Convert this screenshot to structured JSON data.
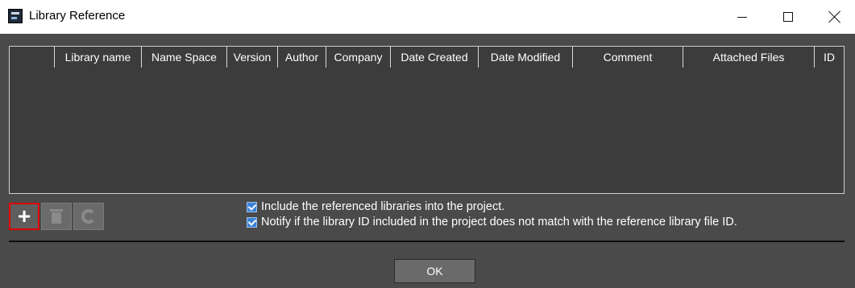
{
  "window": {
    "title": "Library Reference",
    "icon": "library-reference-app-icon",
    "controls": {
      "minimize": "minimize-icon",
      "maximize": "maximize-icon",
      "close": "close-icon"
    }
  },
  "grid": {
    "columns": [
      "",
      "Library name",
      "Name Space",
      "Version",
      "Author",
      "Company",
      "Date Created",
      "Date Modified",
      "Comment",
      "Attached Files",
      "ID"
    ],
    "rows": []
  },
  "toolbar": {
    "add_icon": "plus-icon",
    "delete_icon": "trash-icon",
    "refresh_icon": "refresh-icon",
    "add_label": "+"
  },
  "options": {
    "include_label": "Include the referenced libraries into the project.",
    "include_checked": true,
    "notify_label": "Notify if the library ID included in the project does not match with the reference library file ID.",
    "notify_checked": true
  },
  "footer": {
    "ok_label": "OK"
  },
  "colors": {
    "background": "#4a4a4a",
    "grid_background": "#3c3c3c",
    "checkbox": "#3b82d8",
    "highlight": "#e00000"
  }
}
